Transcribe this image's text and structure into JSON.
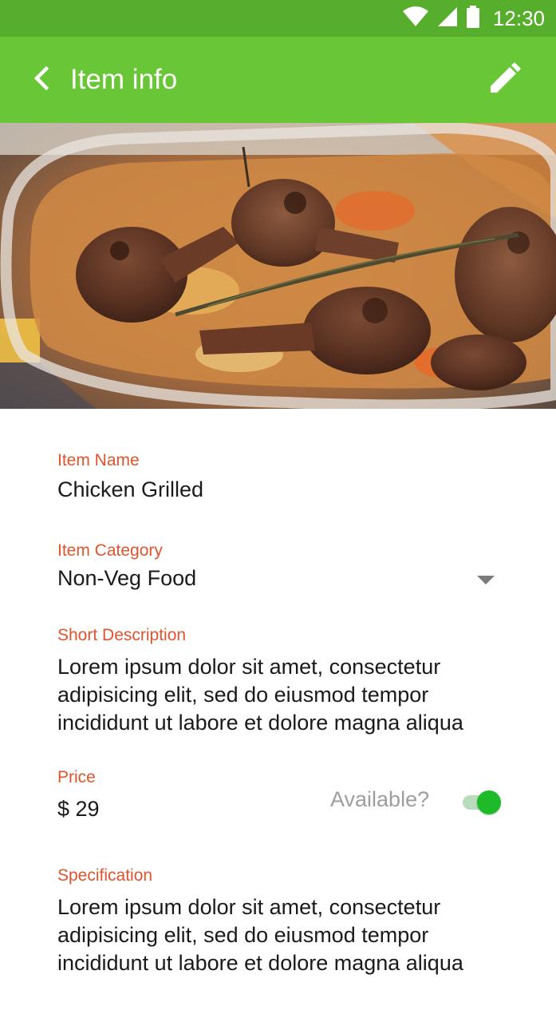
{
  "status_bar": {
    "time": "12:30",
    "icons": [
      "wifi-icon",
      "cell-signal-icon",
      "battery-icon"
    ],
    "background": "#57ad2c"
  },
  "app_bar": {
    "title": "Item info",
    "back_icon": "chevron-left-icon",
    "edit_icon": "pencil-icon",
    "background": "#69c637"
  },
  "hero_image": {
    "subject": "grilled chicken drumsticks in glass baking dish"
  },
  "form": {
    "item_name": {
      "label": "Item Name",
      "value": "Chicken Grilled"
    },
    "item_category": {
      "label": "Item Category",
      "value": "Non-Veg Food",
      "icon": "dropdown-arrow-icon"
    },
    "short_description": {
      "label": "Short Description",
      "lines": [
        "Lorem ipsum dolor sit amet, consectetur",
        "adipisicing elit, sed do eiusmod tempor",
        "incididunt ut labore et dolore magna aliqua"
      ]
    },
    "price": {
      "label": "Price",
      "value": "$ 29"
    },
    "availability": {
      "label": "Available?",
      "enabled": true,
      "accent": "#1fba2a"
    },
    "specification": {
      "label": "Specification",
      "lines": [
        "Lorem ipsum dolor sit amet, consectetur",
        "adipisicing elit, sed do eiusmod tempor",
        "incididunt ut labore et dolore magna aliqua"
      ]
    }
  },
  "colors": {
    "label": "#e0542d",
    "text": "#1a1a1a",
    "muted": "#9e9e9e"
  }
}
